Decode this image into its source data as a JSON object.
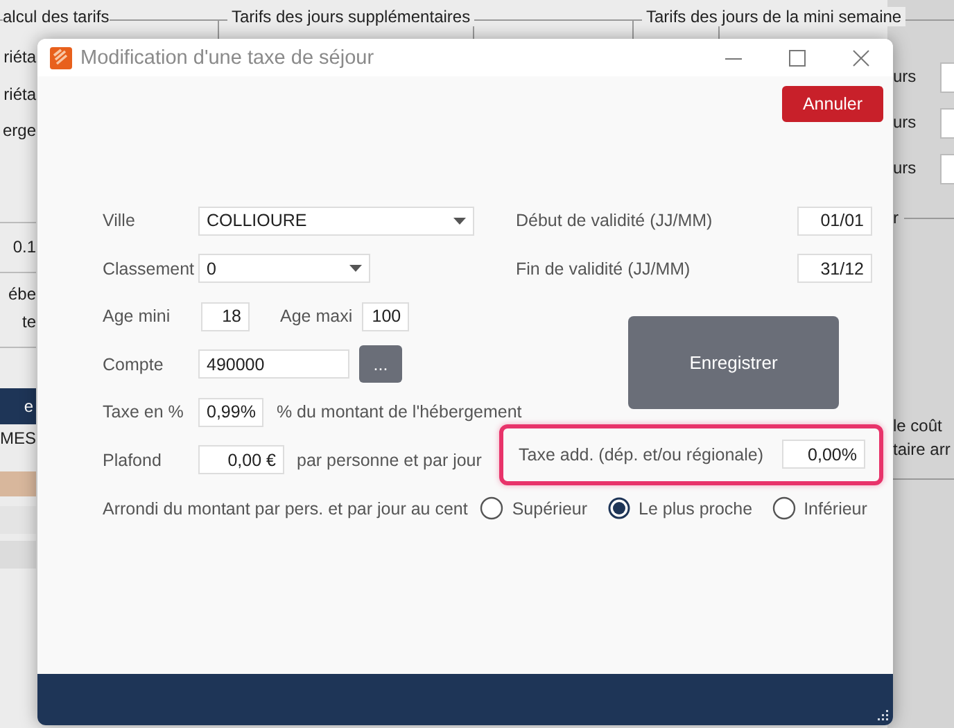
{
  "background_window": {
    "group_titles": [
      "alcul des tarifs",
      "Tarifs des jours supplémentaires",
      "Tarifs des jours de la mini semaine"
    ],
    "left_texts": [
      {
        "text": "riéta",
        "kind": "plain"
      },
      {
        "text": "riéta",
        "kind": "plain"
      },
      {
        "text": "erge",
        "kind": "plain"
      },
      {
        "text": "0.1",
        "kind": "plain"
      },
      {
        "text": "ébe",
        "kind": "plain"
      },
      {
        "text": "te",
        "kind": "plain"
      },
      {
        "text": "e",
        "kind": "selected"
      },
      {
        "text": "MES",
        "kind": "plain"
      }
    ],
    "right_texts": [
      {
        "text": "urs"
      },
      {
        "text": "urs"
      },
      {
        "text": "urs"
      },
      {
        "text": "r"
      },
      {
        "text": "le coût"
      },
      {
        "text": "taire arr"
      }
    ]
  },
  "dialog": {
    "title": "Modification d'une taxe de séjour",
    "cancel_button": "Annuler",
    "ville": {
      "label": "Ville",
      "value": "COLLIOURE"
    },
    "classement": {
      "label": "Classement",
      "value": "0"
    },
    "age_mini": {
      "label": "Age mini",
      "value": "18"
    },
    "age_maxi": {
      "label": "Age maxi",
      "value": "100"
    },
    "compte": {
      "label": "Compte",
      "value": "490000",
      "button": "..."
    },
    "taxe_pct": {
      "label": "Taxe en %",
      "value": "0,99%",
      "suffix": "% du montant de l'hébergement"
    },
    "plafond": {
      "label": "Plafond",
      "value": "0,00 €",
      "suffix": "par personne et par jour"
    },
    "debut": {
      "label": "Début de validité (JJ/MM)",
      "value": "01/01"
    },
    "fin": {
      "label": "Fin  de validité (JJ/MM)",
      "value": "31/12"
    },
    "save_button": "Enregistrer",
    "taxe_add": {
      "label": "Taxe add. (dép. et/ou régionale)",
      "value": "0,00%",
      "highlighted": true
    },
    "rounding": {
      "label": "Arrondi du montant par pers. et par jour au cent",
      "options": [
        {
          "label": "Supérieur",
          "selected": false
        },
        {
          "label": "Le plus proche",
          "selected": true
        },
        {
          "label": "Inférieur",
          "selected": false
        }
      ]
    }
  }
}
